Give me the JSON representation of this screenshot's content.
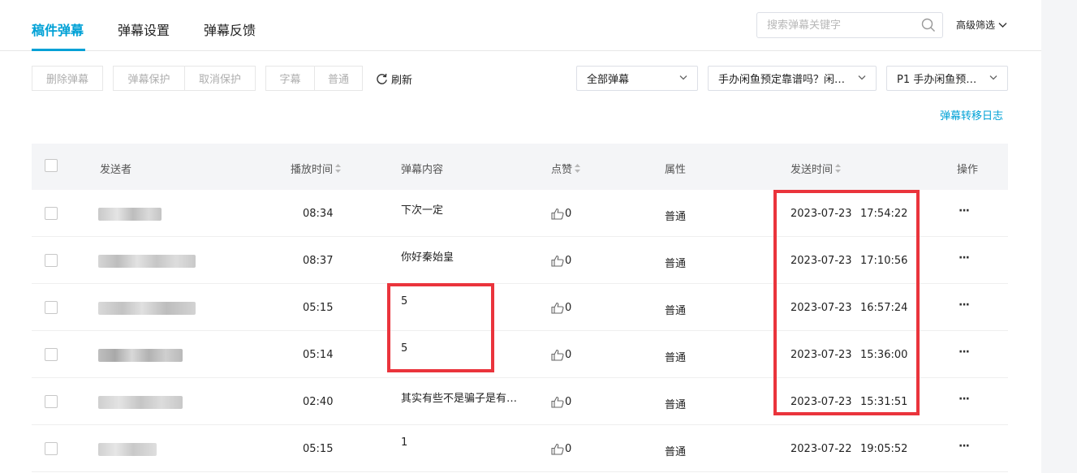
{
  "tabs": [
    {
      "label": "稿件弹幕",
      "active": true
    },
    {
      "label": "弹幕设置",
      "active": false
    },
    {
      "label": "弹幕反馈",
      "active": false
    }
  ],
  "search": {
    "placeholder": "搜索弹幕关键字",
    "value": ""
  },
  "advanced_filter": {
    "label": "高级筛选"
  },
  "toolbar": {
    "delete": "删除弹幕",
    "protect": "弹幕保护",
    "unprotect": "取消保护",
    "subtitle": "字幕",
    "normal": "普通",
    "refresh": "刷新"
  },
  "filters": {
    "scope": "全部弹幕",
    "video": "手办闲鱼预定靠谱吗？闲…",
    "part": "P1 手办闲鱼预…"
  },
  "move_log": "弹幕转移日志",
  "table": {
    "headers": {
      "sender": "发送者",
      "play_time": "播放时间",
      "content": "弹幕内容",
      "likes": "点赞",
      "attr": "属性",
      "send_time": "发送时间",
      "actions": "操作"
    },
    "rows": [
      {
        "play_time": "08:34",
        "content": "下次一定",
        "likes": "0",
        "attr": "普通",
        "date": "2023-07-23",
        "time": "17:54:22",
        "more": "···"
      },
      {
        "play_time": "08:37",
        "content": "你好秦始皇",
        "likes": "0",
        "attr": "普通",
        "date": "2023-07-23",
        "time": "17:10:56",
        "more": "···"
      },
      {
        "play_time": "05:15",
        "content": "5",
        "likes": "0",
        "attr": "普通",
        "date": "2023-07-23",
        "time": "16:57:24",
        "more": "···"
      },
      {
        "play_time": "05:14",
        "content": "5",
        "likes": "0",
        "attr": "普通",
        "date": "2023-07-23",
        "time": "15:36:00",
        "more": "···"
      },
      {
        "play_time": "02:40",
        "content": "其实有些不是骗子是有…",
        "likes": "0",
        "attr": "普通",
        "date": "2023-07-23",
        "time": "15:31:51",
        "more": "···"
      },
      {
        "play_time": "05:15",
        "content": "1",
        "likes": "0",
        "attr": "普通",
        "date": "2023-07-22",
        "time": "19:05:52",
        "more": "···"
      }
    ]
  },
  "colors": {
    "accent": "#00a1d6",
    "highlight": "#ea343c"
  }
}
